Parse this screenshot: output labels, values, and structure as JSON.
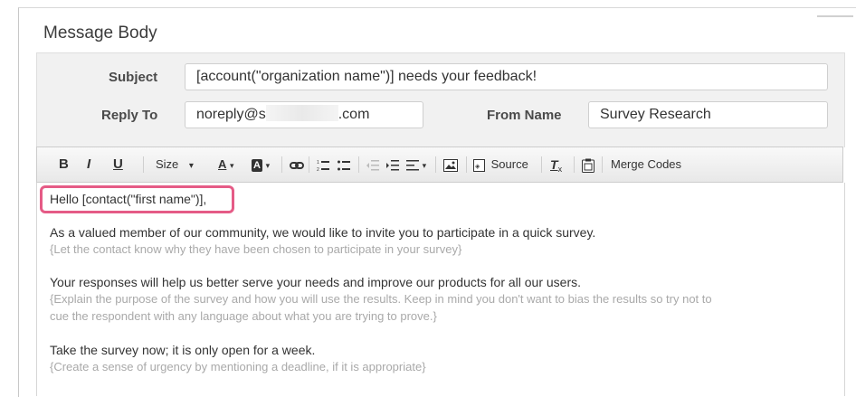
{
  "section_title": "Message Body",
  "subject": {
    "label": "Subject",
    "value": "[account(\"organization name\")] needs your feedback!"
  },
  "reply_to": {
    "label": "Reply To",
    "value_prefix": "noreply@s",
    "value_suffix": ".com"
  },
  "from_name": {
    "label": "From Name",
    "value": "Survey Research"
  },
  "toolbar": {
    "bold": "B",
    "italic": "I",
    "underline": "U",
    "size": "Size",
    "font_color": "A",
    "bg_color": "A",
    "source": "Source",
    "merge_codes": "Merge Codes"
  },
  "body": {
    "greeting": "Hello [contact(\"first name\")],",
    "p1": "As a valued member of our community, we would like to invite you to participate in a quick survey.",
    "p1_hint": "{Let the contact know why they have been chosen to participate in your survey}",
    "p2": "Your responses will help us better serve your needs and improve our products for all our users.",
    "p2_hint_1": "{Explain the purpose of the survey and how you will use the results. Keep in mind you don't want to bias the results so try not to",
    "p2_hint_2": "cue the respondent with any language about what you are trying to prove.}",
    "p3": "Take the survey now; it is only open for a week.",
    "p3_hint": "{Create a sense of urgency by mentioning a deadline, if it is appropriate}"
  },
  "colors": {
    "highlight": "#e55b86",
    "hint_text": "#a9a9a9"
  }
}
